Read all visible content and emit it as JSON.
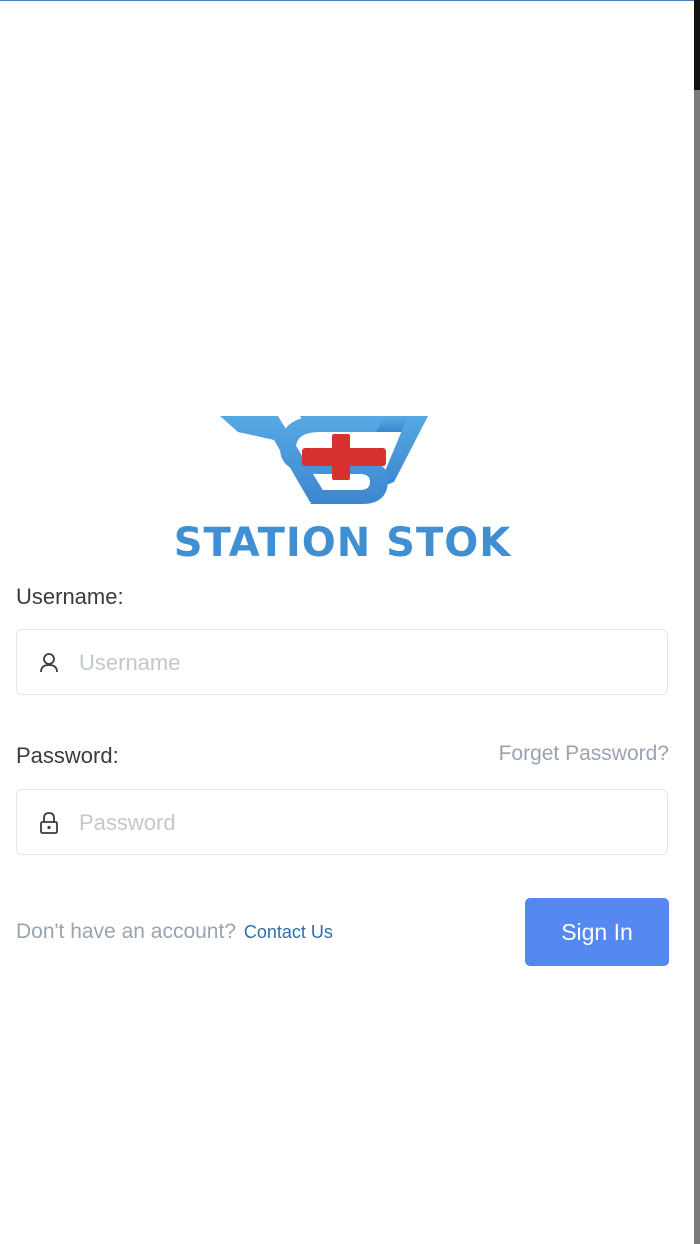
{
  "brand": {
    "name": "STATION STOK",
    "logo_icon": "station-stok-logo-icon",
    "colors": {
      "blue": "#3f8fd2",
      "red": "#d93030"
    }
  },
  "form": {
    "username_label": "Username:",
    "username_placeholder": "Username",
    "username_icon": "user-icon",
    "password_label": "Password:",
    "password_placeholder": "Password",
    "password_icon": "lock-icon",
    "forgot_password": "Forget Password?",
    "no_account_text": "Don't have an account?",
    "contact_link": "Contact Us",
    "submit_label": "Sign In"
  },
  "colors": {
    "primary_button": "#5588f0",
    "link": "#2f6fa8",
    "muted_text": "#9aa3b0"
  }
}
